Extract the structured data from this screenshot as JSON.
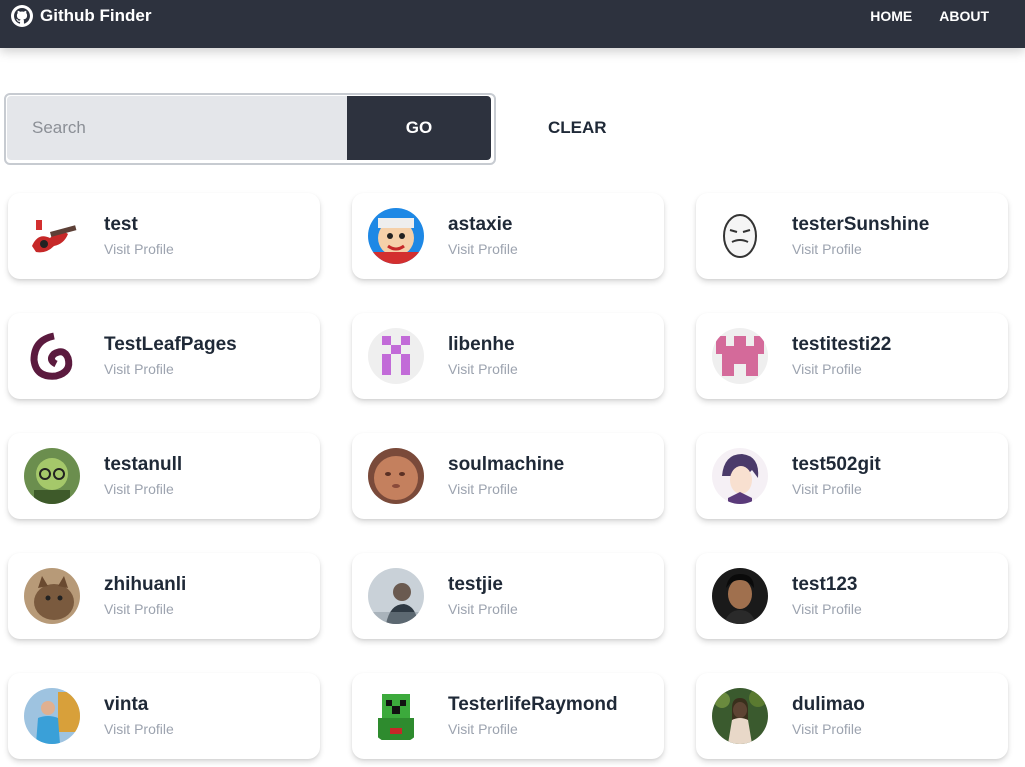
{
  "app": {
    "title": "Github Finder",
    "nav": [
      "HOME",
      "ABOUT"
    ]
  },
  "search": {
    "placeholder": "Search",
    "value": "",
    "go_label": "GO",
    "clear_label": "CLEAR"
  },
  "colors": {
    "navbar": "#2d323e",
    "input_bg": "#e4e6ea",
    "go_button": "#2d323e"
  },
  "users": [
    {
      "login": "test",
      "link": "Visit Profile"
    },
    {
      "login": "astaxie",
      "link": "Visit Profile"
    },
    {
      "login": "testerSunshine",
      "link": "Visit Profile"
    },
    {
      "login": "TestLeafPages",
      "link": "Visit Profile"
    },
    {
      "login": "libenhe",
      "link": "Visit Profile"
    },
    {
      "login": "testitesti22",
      "link": "Visit Profile"
    },
    {
      "login": "testanull",
      "link": "Visit Profile"
    },
    {
      "login": "soulmachine",
      "link": "Visit Profile"
    },
    {
      "login": "test502git",
      "link": "Visit Profile"
    },
    {
      "login": "zhihuanli",
      "link": "Visit Profile"
    },
    {
      "login": "testjie",
      "link": "Visit Profile"
    },
    {
      "login": "test123",
      "link": "Visit Profile"
    },
    {
      "login": "vinta",
      "link": "Visit Profile"
    },
    {
      "login": "TesterlifeRaymond",
      "link": "Visit Profile"
    },
    {
      "login": "dulimao",
      "link": "Visit Profile"
    }
  ]
}
